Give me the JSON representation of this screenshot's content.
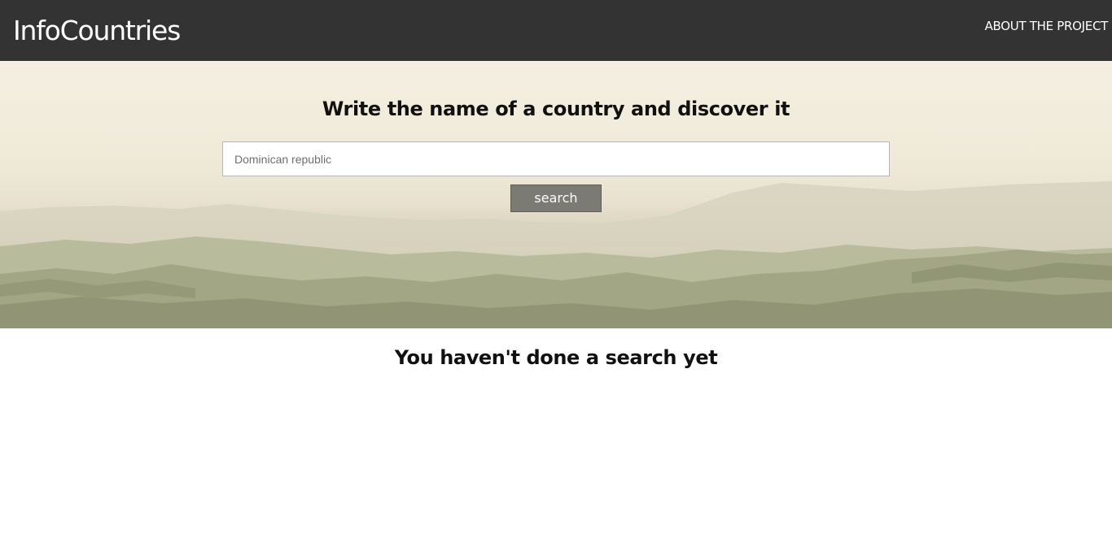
{
  "navbar": {
    "brand": "InfoCountries",
    "link": "ABOUT THE PROJECT",
    "background": "#333333"
  },
  "hero": {
    "title": "Write the name of a country and discover it",
    "search": {
      "placeholder": "Dominican republic",
      "button_label": "search"
    },
    "background_image": "misty-mountain-landscape"
  },
  "results": {
    "empty_message": "You haven't done a search yet"
  },
  "colors": {
    "button": "#7b7a73",
    "text": "#111111"
  }
}
